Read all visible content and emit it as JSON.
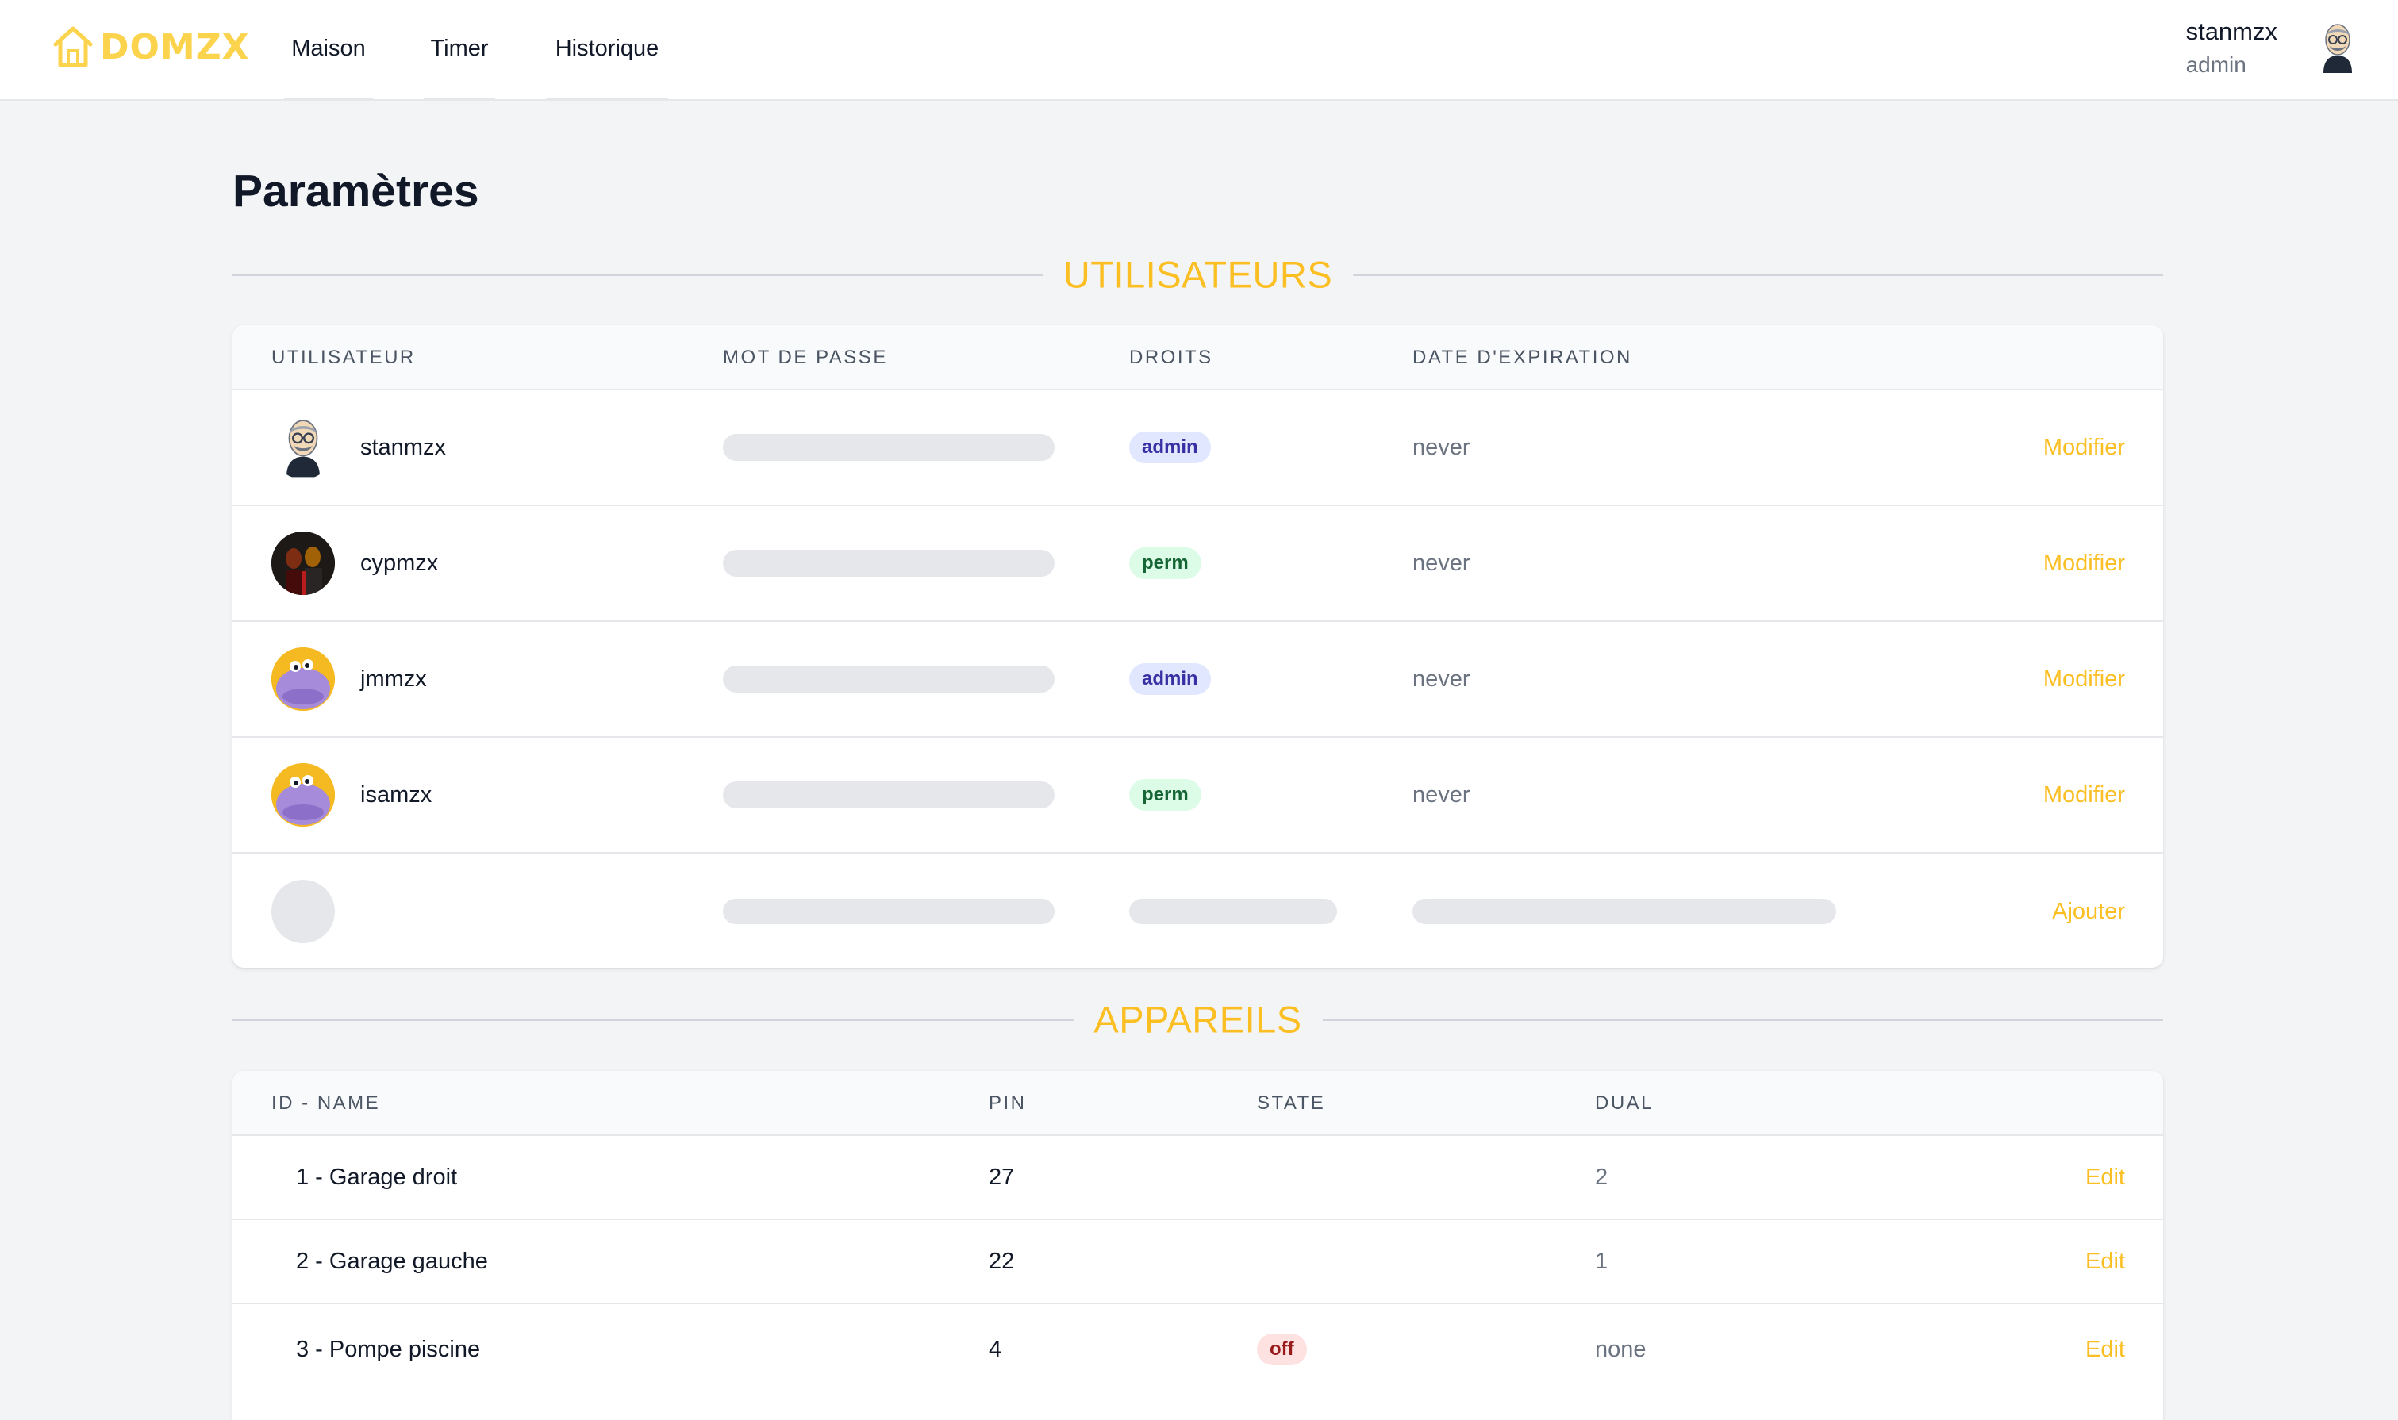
{
  "brand": {
    "name": "DOMZX",
    "color": "#fcd34d",
    "icon": "house-icon"
  },
  "nav": [
    {
      "label": "Maison"
    },
    {
      "label": "Timer"
    },
    {
      "label": "Historique"
    }
  ],
  "current_user": {
    "name": "stanmzx",
    "role": "admin",
    "avatar": "avatar-cartoon-icon"
  },
  "page": {
    "title": "Paramètres"
  },
  "users_section": {
    "title": "UTILISATEURS",
    "columns": [
      "UTILISATEUR",
      "MOT DE PASSE",
      "DROITS",
      "DATE D'EXPIRATION"
    ],
    "rows": [
      {
        "name": "stanmzx",
        "avatar": "cartoon-man-avatar",
        "rights": "admin",
        "expiration": "never",
        "action": "Modifier"
      },
      {
        "name": "cypmzx",
        "avatar": "photo-avatar",
        "rights": "perm",
        "expiration": "never",
        "action": "Modifier"
      },
      {
        "name": "jmmzx",
        "avatar": "purple-creature-avatar",
        "rights": "admin",
        "expiration": "never",
        "action": "Modifier"
      },
      {
        "name": "isamzx",
        "avatar": "purple-creature-avatar",
        "rights": "perm",
        "expiration": "never",
        "action": "Modifier"
      }
    ],
    "add_action": "Ajouter"
  },
  "devices_section": {
    "title": "APPAREILS",
    "columns": [
      "ID - NAME",
      "PIN",
      "STATE",
      "DUAL"
    ],
    "rows": [
      {
        "name": "1 - Garage droit",
        "pin": "27",
        "state": "",
        "dual": "2",
        "action": "Edit"
      },
      {
        "name": "2 - Garage gauche",
        "pin": "22",
        "state": "",
        "dual": "1",
        "action": "Edit"
      },
      {
        "name": "3 - Pompe piscine",
        "pin": "4",
        "state": "off",
        "dual": "none",
        "action": "Edit"
      }
    ]
  },
  "colors": {
    "accent": "#fbbf24",
    "admin_badge": "#e0e7ff",
    "perm_badge": "#dcfce7",
    "off_badge": "#fee2e2"
  }
}
